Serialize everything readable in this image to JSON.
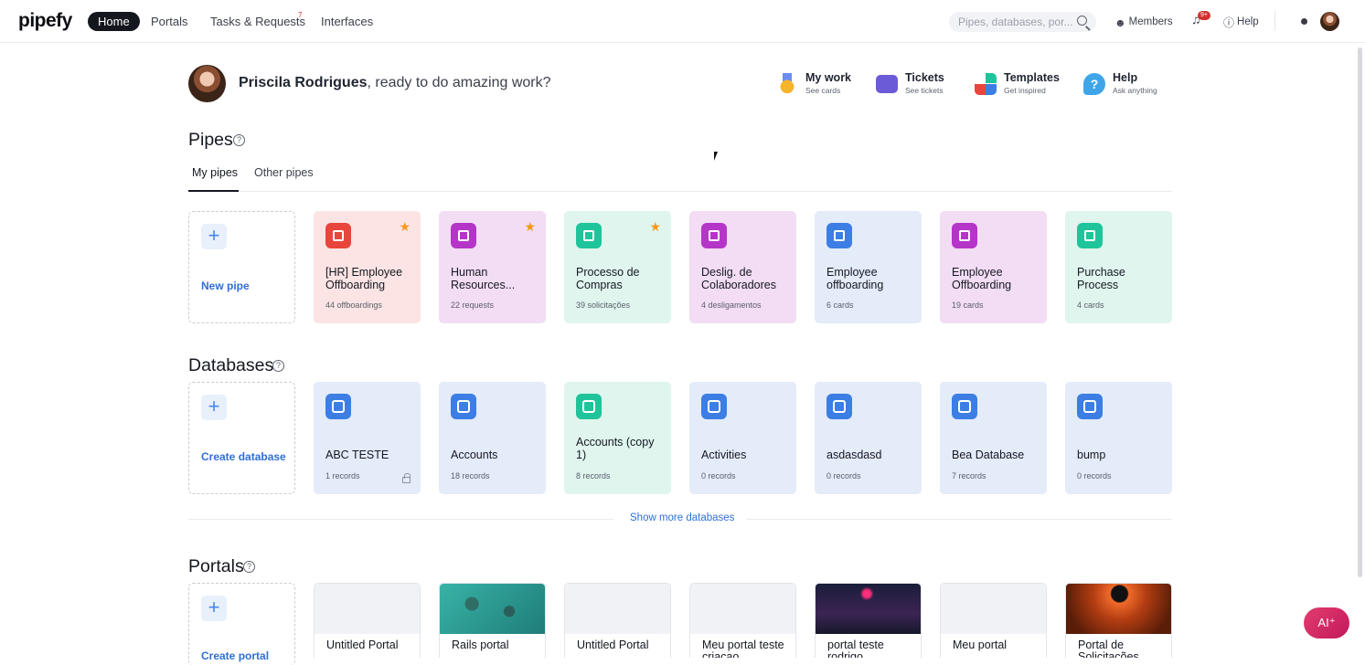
{
  "header": {
    "logo": "pipefy",
    "nav": [
      {
        "label": "Home"
      },
      {
        "label": "Portals"
      },
      {
        "label": "Tasks & Requests"
      },
      {
        "label": "Interfaces"
      }
    ],
    "tasks_badge": "7",
    "search_placeholder": "Pipes, databases, por...",
    "members_label": "Members",
    "notifications_badge": "9+",
    "help_label": "Help"
  },
  "welcome": {
    "user_name": "Priscila Rodrigues",
    "message": ", ready to do amazing work?"
  },
  "shortcuts": [
    {
      "title": "My work",
      "subtitle": "See cards"
    },
    {
      "title": "Tickets",
      "subtitle": "See tickets"
    },
    {
      "title": "Templates",
      "subtitle": "Get inspired"
    },
    {
      "title": "Help",
      "subtitle": "Ask anything"
    }
  ],
  "pipes": {
    "title": "Pipes",
    "tabs": [
      {
        "label": "My pipes"
      },
      {
        "label": "Other pipes"
      }
    ],
    "new_label": "New pipe",
    "items": [
      {
        "name": "[HR] Employee Offboarding",
        "count": "44 offboardings",
        "starred": true,
        "bg": "#fce4e4",
        "icon_color": "#e8453c"
      },
      {
        "name": "Human Resources...",
        "count": "22 requests",
        "starred": true,
        "bg": "#f3ddf4",
        "icon_color": "#b635c9"
      },
      {
        "name": "Processo de Compras",
        "count": "39 solicitações",
        "starred": true,
        "bg": "#dff5ee",
        "icon_color": "#1fc49a"
      },
      {
        "name": "Deslig. de Colaboradores",
        "count": "4 desligamentos",
        "starred": false,
        "bg": "#f3ddf4",
        "icon_color": "#b635c9"
      },
      {
        "name": "Employee offboarding",
        "count": "6 cards",
        "starred": false,
        "bg": "#e4ebf9",
        "icon_color": "#3c7ee3"
      },
      {
        "name": "Employee Offboarding",
        "count": "19 cards",
        "starred": false,
        "bg": "#f3ddf4",
        "icon_color": "#b635c9"
      },
      {
        "name": "Purchase Process",
        "count": "4 cards",
        "starred": false,
        "bg": "#dff5ee",
        "icon_color": "#1fc49a"
      }
    ]
  },
  "databases": {
    "title": "Databases",
    "create_label": "Create database",
    "show_more": "Show more databases",
    "items": [
      {
        "name": "ABC TESTE",
        "count": "1 records",
        "bg": "#e4ebf9",
        "icon_color": "#3c7ee3",
        "locked": true
      },
      {
        "name": "Accounts",
        "count": "18 records",
        "bg": "#e4ebf9",
        "icon_color": "#3c7ee3",
        "locked": false
      },
      {
        "name": "Accounts (copy 1)",
        "count": "8 records",
        "bg": "#dff5ee",
        "icon_color": "#1fc49a",
        "locked": false
      },
      {
        "name": "Activities",
        "count": "0 records",
        "bg": "#e4ebf9",
        "icon_color": "#3c7ee3",
        "locked": false
      },
      {
        "name": "asdasdasd",
        "count": "0 records",
        "bg": "#e4ebf9",
        "icon_color": "#3c7ee3",
        "locked": false
      },
      {
        "name": "Bea Database",
        "count": "7 records",
        "bg": "#e4ebf9",
        "icon_color": "#3c7ee3",
        "locked": false
      },
      {
        "name": "bump",
        "count": "0 records",
        "bg": "#e4ebf9",
        "icon_color": "#3c7ee3",
        "locked": false
      }
    ]
  },
  "portals": {
    "title": "Portals",
    "create_label": "Create portal",
    "items": [
      {
        "name": "Untitled Portal",
        "cover": "none"
      },
      {
        "name": "Rails portal",
        "cover": "aerial-water"
      },
      {
        "name": "Untitled Portal",
        "cover": "none"
      },
      {
        "name": "Meu portal teste criacao",
        "cover": "none"
      },
      {
        "name": "portal teste rodrigo",
        "cover": "neon-street"
      },
      {
        "name": "Meu portal",
        "cover": "none"
      },
      {
        "name": "Portal de Solicitações",
        "cover": "fire-tunnel"
      }
    ]
  },
  "ai_button": "AI⁺"
}
